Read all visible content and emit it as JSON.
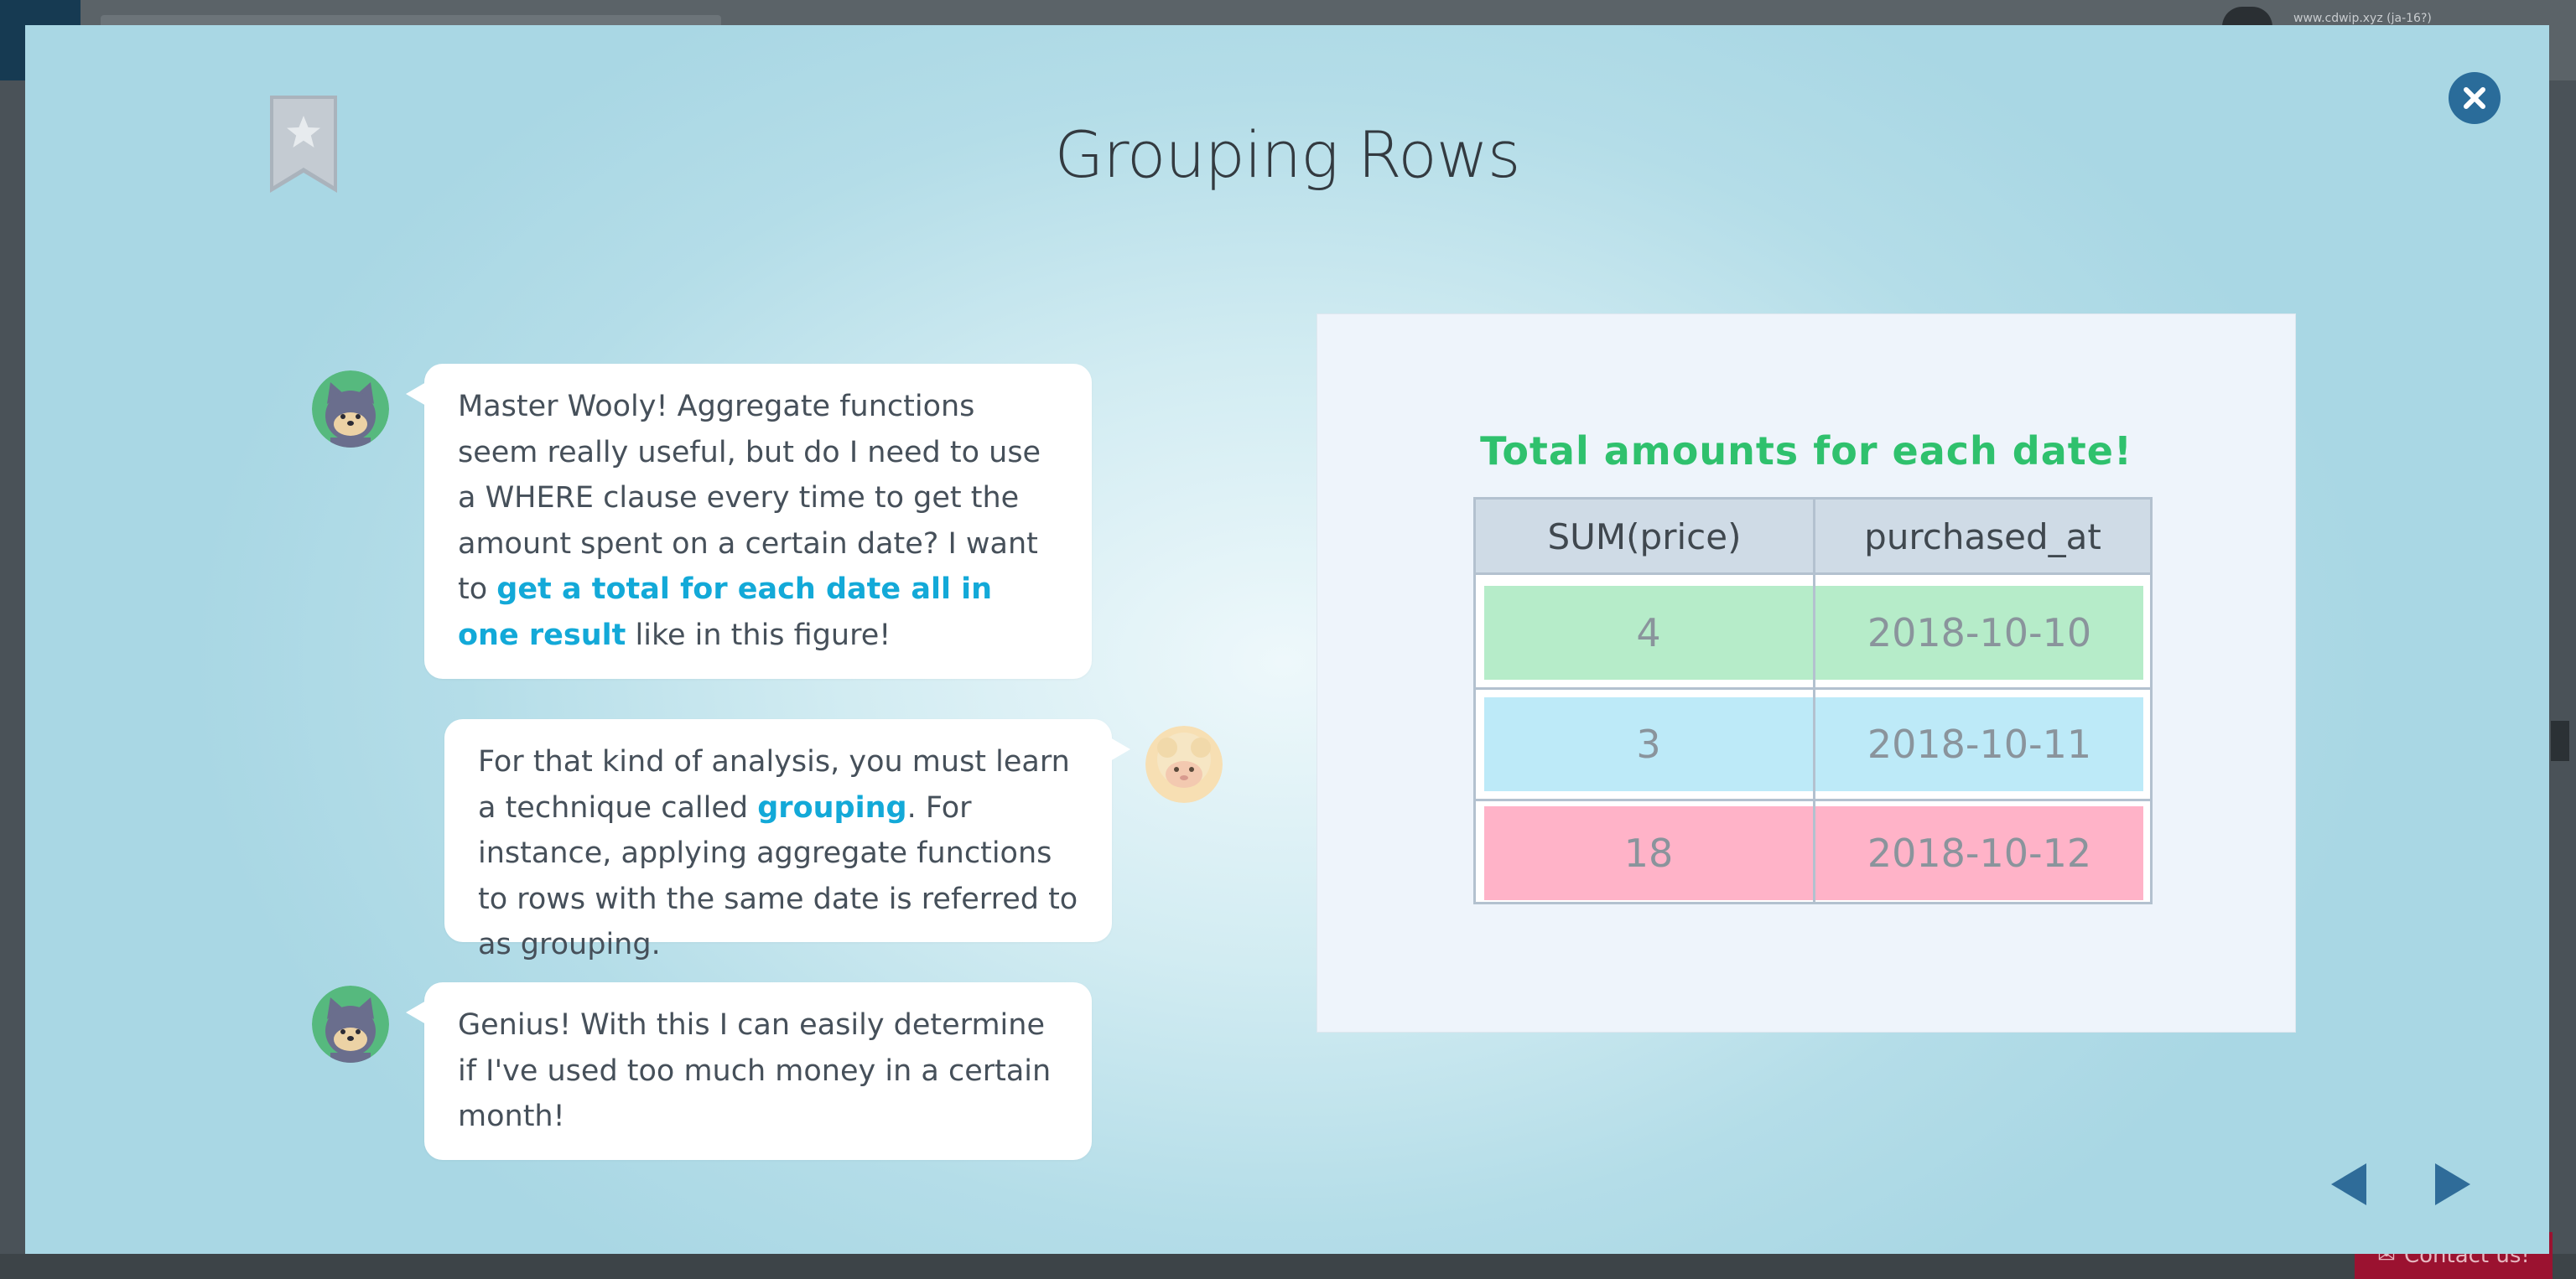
{
  "background_page": {
    "user_text": "www.cdwip.xyz (ja-16?)",
    "contact_label": "Contact us!"
  },
  "modal": {
    "title": "Grouping Rows",
    "close_label": "close",
    "colors": {
      "highlight": "#13a9d8",
      "figure_title": "#2fc16d",
      "close_button": "#2a6c9a",
      "nav_arrow": "#2f6c99"
    }
  },
  "chat": {
    "messages": [
      {
        "speaker": "student",
        "parts": [
          {
            "text": "Master Wooly! Aggregate functions seem really useful, but do I need to use a WHERE clause every time to get the amount spent on a certain date? I want to ",
            "highlight": false
          },
          {
            "text": "get a total for each date all in one result",
            "highlight": true
          },
          {
            "text": " like in this figure!",
            "highlight": false
          }
        ]
      },
      {
        "speaker": "teacher",
        "parts": [
          {
            "text": "For that kind of analysis, you must learn a technique called ",
            "highlight": false
          },
          {
            "text": "grouping",
            "highlight": true
          },
          {
            "text": ". For instance, applying aggregate functions to rows with the same date is referred to as grouping.",
            "highlight": false
          }
        ]
      },
      {
        "speaker": "student",
        "parts": [
          {
            "text": "Genius! With this I can easily determine if I've used too much money in a certain month!",
            "highlight": false
          }
        ]
      }
    ]
  },
  "figure": {
    "title": "Total amounts for each date!",
    "table": {
      "headers": [
        "SUM(price)",
        "purchased_at"
      ],
      "rows": [
        {
          "values": [
            "4",
            "2018-10-10"
          ],
          "color": "#b6ecc9"
        },
        {
          "values": [
            "3",
            "2018-10-11"
          ],
          "color": "#bdeaf8"
        },
        {
          "values": [
            "18",
            "2018-10-12"
          ],
          "color": "#ffb3c8"
        }
      ]
    }
  },
  "navigation": {
    "prev_icon": "triangle-left-icon",
    "next_icon": "triangle-right-icon"
  }
}
